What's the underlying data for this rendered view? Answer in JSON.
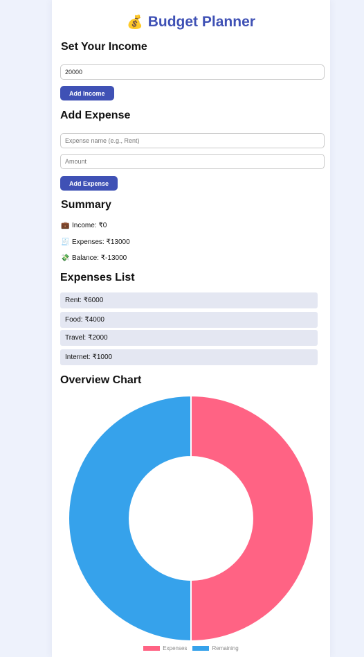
{
  "app": {
    "title": "Budget Planner",
    "title_icon": "money-bag-icon"
  },
  "income_section": {
    "heading": "Set Your Income",
    "input_value": "20000",
    "button_label": "Add Income"
  },
  "expense_section": {
    "heading": "Add Expense",
    "name_placeholder": "Expense name (e.g., Rent)",
    "amount_placeholder": "Amount",
    "button_label": "Add Expense"
  },
  "summary": {
    "heading": "Summary",
    "income": {
      "icon": "💼",
      "text": "Income: ₹0"
    },
    "expenses": {
      "icon": "🧾",
      "text": "Expenses: ₹13000"
    },
    "balance": {
      "icon": "💸",
      "text": "Balance: ₹-13000"
    }
  },
  "expenses_list": {
    "heading": "Expenses List",
    "items": [
      "Rent: ₹6000",
      "Food: ₹4000",
      "Travel: ₹2000",
      "Internet: ₹1000"
    ]
  },
  "chart_section": {
    "heading": "Overview Chart"
  },
  "chart_data": {
    "type": "pie",
    "variant": "doughnut",
    "categories": [
      "Expenses",
      "Remaining"
    ],
    "values": [
      13000,
      -13000
    ],
    "rendered_share": [
      0.5,
      0.5
    ],
    "colors": [
      "#ff6384",
      "#36a2eb"
    ],
    "legend_position": "bottom"
  }
}
